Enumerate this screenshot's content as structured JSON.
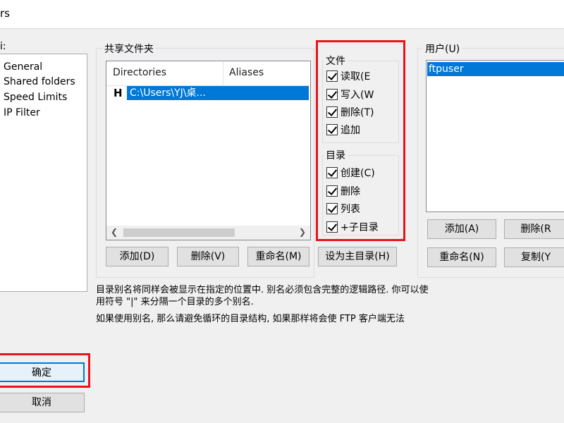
{
  "window": {
    "title_fragment": "rs"
  },
  "left": {
    "page_label": "i:",
    "tree_items": [
      "General",
      "Shared folders",
      "Speed Limits",
      "IP Filter"
    ],
    "ok_label": "确定",
    "cancel_label": "取消"
  },
  "shared": {
    "title": "共享文件夹",
    "col_directories": "Directories",
    "col_aliases": "Aliases",
    "home_mark": "H",
    "row_path": "C:\\Users\\YJ\\桌...",
    "btn_add": "添加(D)",
    "btn_remove": "删除(V)",
    "btn_rename": "重命名(M)",
    "btn_set_home": "设为主目录(H)"
  },
  "perms": {
    "files_title": "文件",
    "files": [
      "读取(E",
      "写入(W",
      "删除(T)",
      "追加"
    ],
    "dirs_title": "目录",
    "dirs": [
      "创建(C)",
      "删除",
      "列表",
      "+子目录"
    ]
  },
  "users": {
    "title": "用户(U)",
    "selected_user": "ftpuser",
    "btn_add": "添加(A)",
    "btn_remove": "删除(R",
    "btn_rename": "重命名(N)",
    "btn_copy": "复制(Y"
  },
  "info": {
    "line1": "目录别名将同样会被显示在指定的位置中. 别名必须包含完整的逻辑路径. 你可以使",
    "line2": "用符号 \"|\" 来分隔一个目录的多个别名.",
    "line3": "如果使用别名, 那么请避免循环的目录结构, 如果那样将会使 FTP 客户端无法"
  },
  "colors": {
    "selection": "#0078d7",
    "highlight": "#e8141d"
  }
}
